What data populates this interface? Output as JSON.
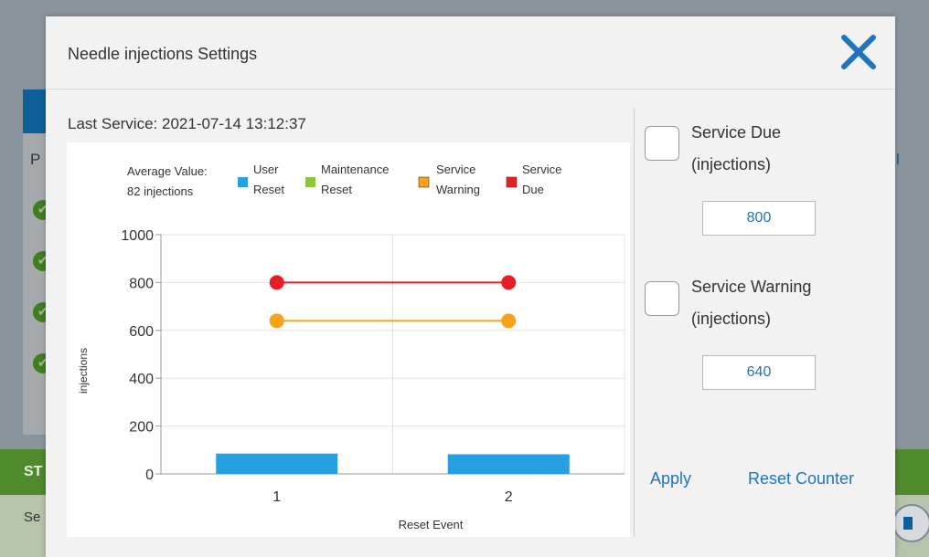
{
  "background": {
    "column_letter": "P",
    "right_glyph": "l",
    "green_bar_label": "ST",
    "light_bar_label": "Se"
  },
  "modal": {
    "title": "Needle injections Settings",
    "close_icon": "close-icon",
    "last_service_label": "Last Service:",
    "last_service_value": "2021-07-14 13:12:37"
  },
  "settings": {
    "service_due_label_line1": "Service Due",
    "service_due_label_line2": "(injections)",
    "service_due_value": "800",
    "service_due_checked": false,
    "service_warning_label_line1": "Service Warning",
    "service_warning_label_line2": "(injections)",
    "service_warning_value": "640",
    "service_warning_checked": false,
    "apply_label": "Apply",
    "reset_counter_label": "Reset Counter"
  },
  "colors": {
    "accent": "#1f74bd",
    "user_reset": "#26a0e0",
    "maintenance_reset": "#8cc63f",
    "service_warning": "#f7a21b",
    "service_due": "#e81e25"
  },
  "chart_data": {
    "type": "bar",
    "average_label_line1": "Average Value:",
    "average_label_line2": "82 injections",
    "legend": [
      {
        "line1": "User",
        "line2": "Reset",
        "color": "#26a0e0",
        "marker": "square"
      },
      {
        "line1": "Maintenance",
        "line2": "Reset",
        "color": "#8cc63f",
        "marker": "square"
      },
      {
        "line1": "Service",
        "line2": "Warning",
        "color": "#f7a21b",
        "marker": "square"
      },
      {
        "line1": "Service",
        "line2": "Due",
        "color": "#e81e25",
        "marker": "square"
      }
    ],
    "categories": [
      "1",
      "2"
    ],
    "series": [
      {
        "name": "User Reset",
        "kind": "bar",
        "values": [
          85,
          82
        ]
      },
      {
        "name": "Service Warning",
        "kind": "line",
        "values": [
          640,
          640
        ]
      },
      {
        "name": "Service Due",
        "kind": "line",
        "values": [
          800,
          800
        ]
      }
    ],
    "xlabel": "Reset Event",
    "ylabel": "injections",
    "ylim": [
      0,
      1000
    ],
    "yticks": [
      0,
      200,
      400,
      600,
      800,
      1000
    ],
    "grid": true
  }
}
